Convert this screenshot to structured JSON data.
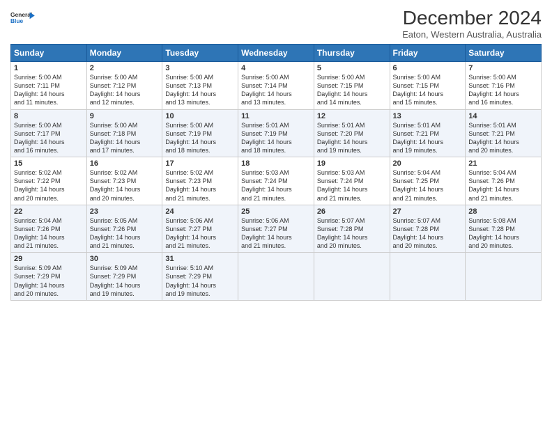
{
  "logo": {
    "line1": "General",
    "line2": "Blue"
  },
  "title": "December 2024",
  "subtitle": "Eaton, Western Australia, Australia",
  "days_header": [
    "Sunday",
    "Monday",
    "Tuesday",
    "Wednesday",
    "Thursday",
    "Friday",
    "Saturday"
  ],
  "weeks": [
    [
      {
        "day": "1",
        "info": "Sunrise: 5:00 AM\nSunset: 7:11 PM\nDaylight: 14 hours\nand 11 minutes."
      },
      {
        "day": "2",
        "info": "Sunrise: 5:00 AM\nSunset: 7:12 PM\nDaylight: 14 hours\nand 12 minutes."
      },
      {
        "day": "3",
        "info": "Sunrise: 5:00 AM\nSunset: 7:13 PM\nDaylight: 14 hours\nand 13 minutes."
      },
      {
        "day": "4",
        "info": "Sunrise: 5:00 AM\nSunset: 7:14 PM\nDaylight: 14 hours\nand 13 minutes."
      },
      {
        "day": "5",
        "info": "Sunrise: 5:00 AM\nSunset: 7:15 PM\nDaylight: 14 hours\nand 14 minutes."
      },
      {
        "day": "6",
        "info": "Sunrise: 5:00 AM\nSunset: 7:15 PM\nDaylight: 14 hours\nand 15 minutes."
      },
      {
        "day": "7",
        "info": "Sunrise: 5:00 AM\nSunset: 7:16 PM\nDaylight: 14 hours\nand 16 minutes."
      }
    ],
    [
      {
        "day": "8",
        "info": "Sunrise: 5:00 AM\nSunset: 7:17 PM\nDaylight: 14 hours\nand 16 minutes."
      },
      {
        "day": "9",
        "info": "Sunrise: 5:00 AM\nSunset: 7:18 PM\nDaylight: 14 hours\nand 17 minutes."
      },
      {
        "day": "10",
        "info": "Sunrise: 5:00 AM\nSunset: 7:19 PM\nDaylight: 14 hours\nand 18 minutes."
      },
      {
        "day": "11",
        "info": "Sunrise: 5:01 AM\nSunset: 7:19 PM\nDaylight: 14 hours\nand 18 minutes."
      },
      {
        "day": "12",
        "info": "Sunrise: 5:01 AM\nSunset: 7:20 PM\nDaylight: 14 hours\nand 19 minutes."
      },
      {
        "day": "13",
        "info": "Sunrise: 5:01 AM\nSunset: 7:21 PM\nDaylight: 14 hours\nand 19 minutes."
      },
      {
        "day": "14",
        "info": "Sunrise: 5:01 AM\nSunset: 7:21 PM\nDaylight: 14 hours\nand 20 minutes."
      }
    ],
    [
      {
        "day": "15",
        "info": "Sunrise: 5:02 AM\nSunset: 7:22 PM\nDaylight: 14 hours\nand 20 minutes."
      },
      {
        "day": "16",
        "info": "Sunrise: 5:02 AM\nSunset: 7:23 PM\nDaylight: 14 hours\nand 20 minutes."
      },
      {
        "day": "17",
        "info": "Sunrise: 5:02 AM\nSunset: 7:23 PM\nDaylight: 14 hours\nand 21 minutes."
      },
      {
        "day": "18",
        "info": "Sunrise: 5:03 AM\nSunset: 7:24 PM\nDaylight: 14 hours\nand 21 minutes."
      },
      {
        "day": "19",
        "info": "Sunrise: 5:03 AM\nSunset: 7:24 PM\nDaylight: 14 hours\nand 21 minutes."
      },
      {
        "day": "20",
        "info": "Sunrise: 5:04 AM\nSunset: 7:25 PM\nDaylight: 14 hours\nand 21 minutes."
      },
      {
        "day": "21",
        "info": "Sunrise: 5:04 AM\nSunset: 7:26 PM\nDaylight: 14 hours\nand 21 minutes."
      }
    ],
    [
      {
        "day": "22",
        "info": "Sunrise: 5:04 AM\nSunset: 7:26 PM\nDaylight: 14 hours\nand 21 minutes."
      },
      {
        "day": "23",
        "info": "Sunrise: 5:05 AM\nSunset: 7:26 PM\nDaylight: 14 hours\nand 21 minutes."
      },
      {
        "day": "24",
        "info": "Sunrise: 5:06 AM\nSunset: 7:27 PM\nDaylight: 14 hours\nand 21 minutes."
      },
      {
        "day": "25",
        "info": "Sunrise: 5:06 AM\nSunset: 7:27 PM\nDaylight: 14 hours\nand 21 minutes."
      },
      {
        "day": "26",
        "info": "Sunrise: 5:07 AM\nSunset: 7:28 PM\nDaylight: 14 hours\nand 20 minutes."
      },
      {
        "day": "27",
        "info": "Sunrise: 5:07 AM\nSunset: 7:28 PM\nDaylight: 14 hours\nand 20 minutes."
      },
      {
        "day": "28",
        "info": "Sunrise: 5:08 AM\nSunset: 7:28 PM\nDaylight: 14 hours\nand 20 minutes."
      }
    ],
    [
      {
        "day": "29",
        "info": "Sunrise: 5:09 AM\nSunset: 7:29 PM\nDaylight: 14 hours\nand 20 minutes."
      },
      {
        "day": "30",
        "info": "Sunrise: 5:09 AM\nSunset: 7:29 PM\nDaylight: 14 hours\nand 19 minutes."
      },
      {
        "day": "31",
        "info": "Sunrise: 5:10 AM\nSunset: 7:29 PM\nDaylight: 14 hours\nand 19 minutes."
      },
      {
        "day": "",
        "info": ""
      },
      {
        "day": "",
        "info": ""
      },
      {
        "day": "",
        "info": ""
      },
      {
        "day": "",
        "info": ""
      }
    ]
  ]
}
